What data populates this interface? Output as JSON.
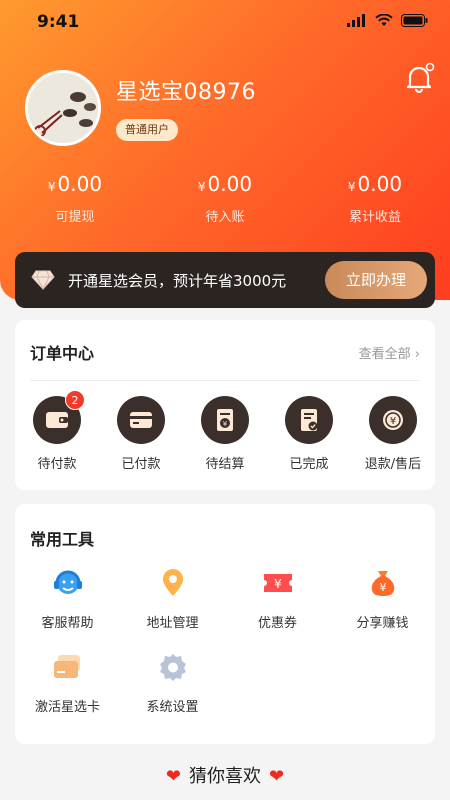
{
  "status": {
    "time": "9:41"
  },
  "profile": {
    "username": "星选宝08976",
    "badge": "普通用户"
  },
  "stats": [
    {
      "currency": "¥",
      "value": "0.00",
      "label": "可提现"
    },
    {
      "currency": "¥",
      "value": "0.00",
      "label": "待入账"
    },
    {
      "currency": "¥",
      "value": "0.00",
      "label": "累计收益"
    }
  ],
  "vip": {
    "text": "开通星选会员，预计年省3000元",
    "button": "立即办理"
  },
  "orders": {
    "title": "订单中心",
    "view_all": "查看全部",
    "items": [
      {
        "label": "待付款",
        "icon": "wallet-icon",
        "badge": "2"
      },
      {
        "label": "已付款",
        "icon": "card-icon"
      },
      {
        "label": "待结算",
        "icon": "bill-icon"
      },
      {
        "label": "已完成",
        "icon": "done-doc-icon"
      },
      {
        "label": "退款/售后",
        "icon": "refund-icon"
      }
    ]
  },
  "tools": {
    "title": "常用工具",
    "items": [
      {
        "label": "客服帮助",
        "icon": "headset-icon"
      },
      {
        "label": "地址管理",
        "icon": "location-icon"
      },
      {
        "label": "优惠券",
        "icon": "coupon-icon"
      },
      {
        "label": "分享赚钱",
        "icon": "money-bag-icon"
      },
      {
        "label": "激活星选卡",
        "icon": "member-card-icon"
      },
      {
        "label": "系统设置",
        "icon": "settings-icon"
      }
    ]
  },
  "guess": {
    "title": "猜你喜欢"
  },
  "colors": {
    "brand_orange": "#ff6a2a",
    "brand_red": "#ff3d1f",
    "vip_dark": "#2b2421",
    "gold": "#e6a879"
  }
}
